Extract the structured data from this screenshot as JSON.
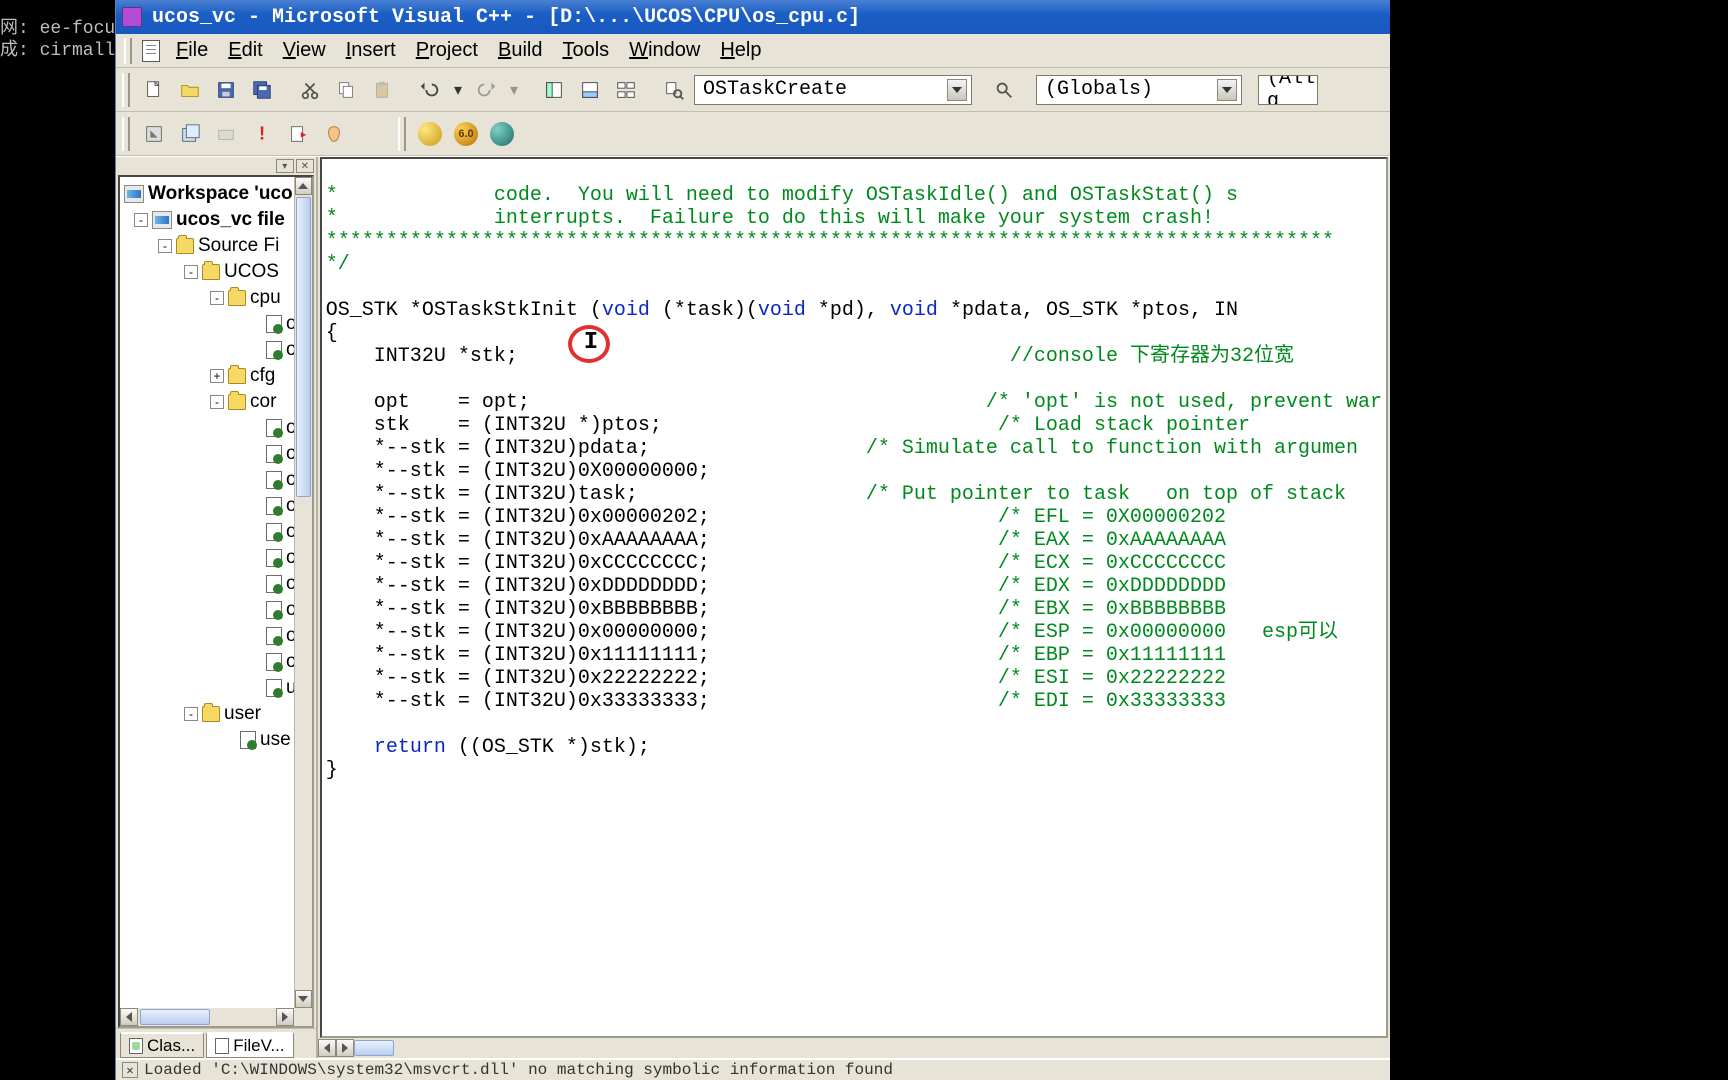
{
  "watermark": {
    "line1": "网: ee-focus",
    "line2": "成: cirmall"
  },
  "title": "ucos_vc - Microsoft Visual C++ - [D:\\...\\UCOS\\CPU\\os_cpu.c]",
  "menus": {
    "file": "File",
    "edit": "Edit",
    "view": "View",
    "insert": "Insert",
    "project": "Project",
    "build": "Build",
    "tools": "Tools",
    "window": "Window",
    "help": "Help"
  },
  "toolbar": {
    "func_combo": "OSTaskCreate",
    "scope_combo": "(Globals)",
    "filter_combo": "(All g"
  },
  "workspace": {
    "root": "Workspace 'uco",
    "proj": "ucos_vc file",
    "src": "Source Fi",
    "ucos": "UCOS",
    "cpu": "cpu",
    "cfg": "cfg",
    "cor": "cor",
    "user": "user",
    "usernode": "use",
    "tab_class": "Clas...",
    "tab_file": "FileV..."
  },
  "code": {
    "l1": "*             code.  You will need to modify OSTaskIdle() and OSTaskStat() s",
    "l2": "*             interrupts.  Failure to do this will make your system crash!",
    "l3": "************************************************************************************",
    "l4": "*/",
    "sig_a": "OS_STK *OSTaskStkInit (",
    "kw_void1": "void",
    "sig_b": " (*task)(",
    "kw_void2": "void",
    "sig_c": " *pd), ",
    "kw_void3": "void",
    "sig_d": " *pdata, OS_STK *ptos, IN",
    "brace_o": "{",
    "decl": "    INT32U *stk;",
    "decl_c": "//console 下寄存器为32位宽",
    "a1": "    opt    = opt;",
    "a1c": "/* 'opt' is not used, prevent war",
    "a2": "    stk    = (INT32U *)ptos;",
    "a2c": "/* Load stack pointer",
    "a3": "    *--stk = (INT32U)pdata;",
    "a3c": "/* Simulate call to function with argumen",
    "a4": "    *--stk = (INT32U)0X00000000;",
    "a5": "    *--stk = (INT32U)task;",
    "a5c": "/* Put pointer to task   on top of stack",
    "a6": "    *--stk = (INT32U)0x00000202;",
    "a6c": "/* EFL = 0X00000202",
    "a7": "    *--stk = (INT32U)0xAAAAAAAA;",
    "a7c": "/* EAX = 0xAAAAAAAA",
    "a8": "    *--stk = (INT32U)0xCCCCCCCC;",
    "a8c": "/* ECX = 0xCCCCCCCC",
    "a9": "    *--stk = (INT32U)0xDDDDDDDD;",
    "a9c": "/* EDX = 0xDDDDDDDD",
    "a10": "    *--stk = (INT32U)0xBBBBBBBB;",
    "a10c": "/* EBX = 0xBBBBBBBB",
    "a11": "    *--stk = (INT32U)0x00000000;",
    "a11c": "/* ESP = 0x00000000   esp可以",
    "a12": "    *--stk = (INT32U)0x11111111;",
    "a12c": "/* EBP = 0x11111111",
    "a13": "    *--stk = (INT32U)0x22222222;",
    "a13c": "/* ESI = 0x22222222",
    "a14": "    *--stk = (INT32U)0x33333333;",
    "a14c": "/* EDI = 0x33333333",
    "kw_return": "return",
    "ret": " ((OS_STK *)stk);",
    "brace_c": "}"
  },
  "status": "Loaded 'C:\\WINDOWS\\system32\\msvcrt.dll'  no matching symbolic information found"
}
